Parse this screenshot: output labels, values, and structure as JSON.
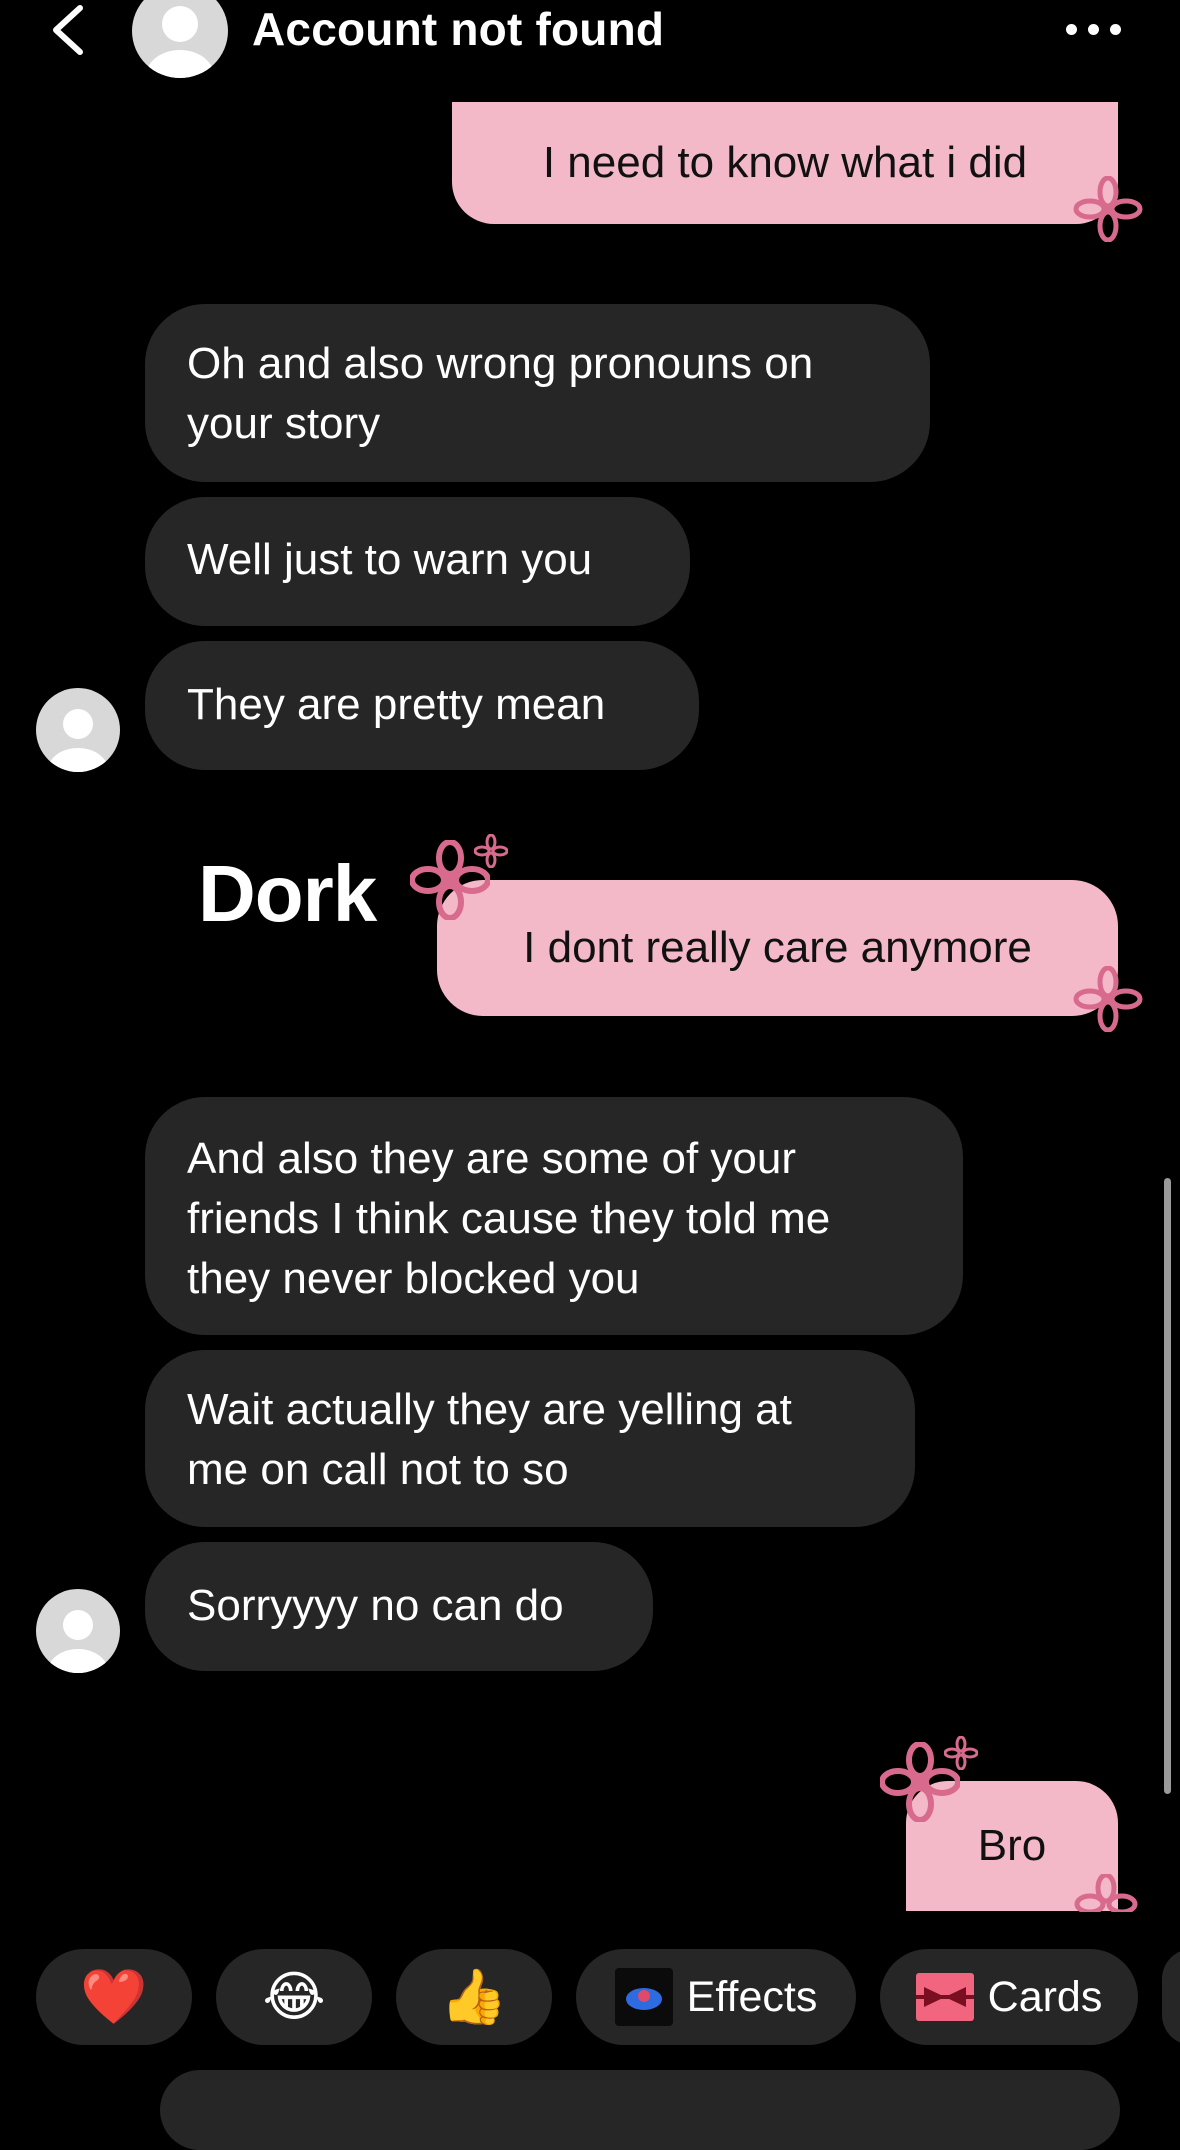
{
  "header": {
    "title": "Account not found",
    "back_icon": "chevron-left-icon",
    "more_icon": "ellipsis-icon"
  },
  "messages": [
    {
      "side": "out",
      "text": "I need to know what i did"
    },
    {
      "side": "in",
      "lines": [
        "Oh and also wrong pronouns on",
        "your story"
      ]
    },
    {
      "side": "in",
      "text": "Well just to warn you"
    },
    {
      "side": "in",
      "text": "They are pretty mean"
    },
    {
      "side": "out",
      "text": "I dont really care anymore"
    },
    {
      "side": "in",
      "lines": [
        "And also they are some of your",
        "friends I think cause they told me",
        "they never blocked you"
      ]
    },
    {
      "side": "in",
      "lines": [
        "Wait actually they are yelling at",
        "me on call not to so"
      ]
    },
    {
      "side": "in",
      "text": "Sorryyyy no can do"
    },
    {
      "side": "out",
      "text": "Bro"
    }
  ],
  "overlay_text": "Dork",
  "quick_actions": {
    "heart": "❤️",
    "laugh": "😂",
    "thumbs_up": "👍",
    "effects_label": "Effects",
    "cards_label": "Cards"
  },
  "colors": {
    "background": "#000000",
    "incoming_bubble": "#262626",
    "outgoing_bubble": "#f4b9c9",
    "flower": "#d86a8e"
  }
}
